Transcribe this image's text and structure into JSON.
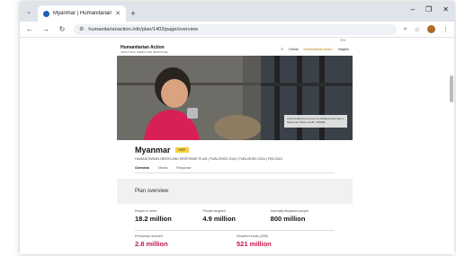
{
  "browser": {
    "tab_title": "Myanmar | Humanitarian Action",
    "url": "humanitarianaction.info/plan/1403/page/overview",
    "profile_color": "#b06a2a"
  },
  "site": {
    "top_line": "EN",
    "logo_name": "Humanitarian Action",
    "logo_tag": "ANALYSING NEEDS AND RESPONSE",
    "nav": [
      "Global",
      "Humanitarian Action",
      "Insights"
    ]
  },
  "hero": {
    "caption": "A girl drinks from a cup in a displacement site in Myanmar. Photo credit: UNICEF"
  },
  "country": {
    "name": "Myanmar",
    "badge": "HRP",
    "subtitle": "HUMANITARIAN NEEDS AND RESPONSE PLAN | PUBLISHED 2024 | PUBLISHED 2024 | FEB 2024"
  },
  "page_tabs": [
    "Overview",
    "Needs",
    "Response"
  ],
  "overview_label": "Plan overview",
  "stats": [
    {
      "label": "People in need",
      "value": "18.2 million"
    },
    {
      "label": "People targeted",
      "value": "4.9 million"
    },
    {
      "label": "Internally displaced people",
      "value": "800 million"
    }
  ],
  "stats2": [
    {
      "label": "Previously reached",
      "value": "2.8 million"
    },
    {
      "label": "Required funds (US$)",
      "value": "521 million"
    }
  ]
}
